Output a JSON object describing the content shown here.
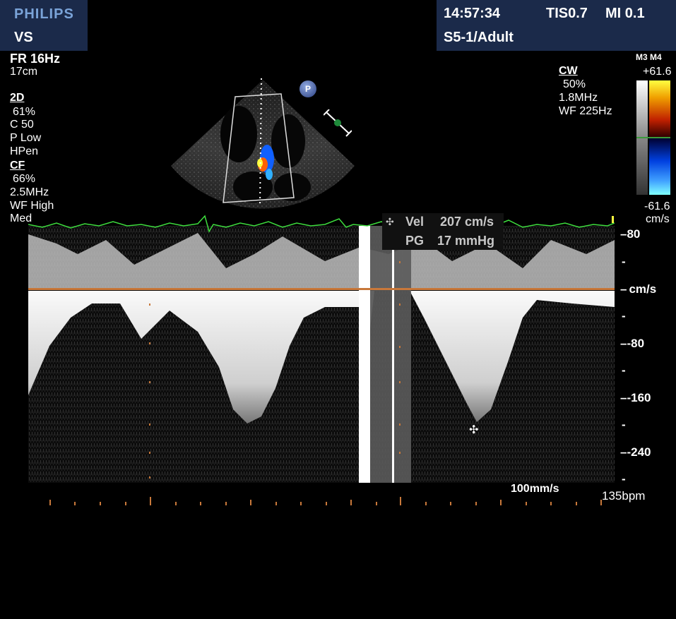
{
  "header": {
    "brand": "PHILIPS",
    "preset": "VS",
    "time": "14:57:34",
    "tis": "TIS0.7",
    "mi": "MI 0.1",
    "probe": "S5-1/Adult"
  },
  "left_panel": {
    "fr": "FR 16Hz",
    "depth": "17cm",
    "section_2d": "2D",
    "twod_items": [
      "61%",
      "C 50",
      "P Low",
      "HPen"
    ],
    "section_cf": "CF",
    "cf_items": [
      "66%",
      "2.5MHz",
      "WF High",
      "Med"
    ]
  },
  "right_panel": {
    "mode": "CW",
    "items": [
      "50%",
      "1.8MHz",
      "WF 225Hz"
    ],
    "colorbar_label": "M3 M4",
    "colorbar_top": "+61.6",
    "colorbar_bottom": "-61.6",
    "colorbar_unit": "cm/s"
  },
  "measurement": {
    "vel_label": "Vel",
    "vel_value": "207 cm/s",
    "pg_label": "PG",
    "pg_value": "17 mmHg"
  },
  "velocity_axis": {
    "ticks": [
      "80",
      "cm/s",
      "-80",
      "-160",
      "-240"
    ]
  },
  "footer": {
    "sweep": "100mm/s",
    "hr": "135bpm"
  },
  "icons": {
    "probe_marker": "P",
    "probe_marker_icon": "probe-orientation-icon",
    "caliper_icon": "caliper-icon",
    "cursor_icon": "crosshair-cursor-icon"
  }
}
